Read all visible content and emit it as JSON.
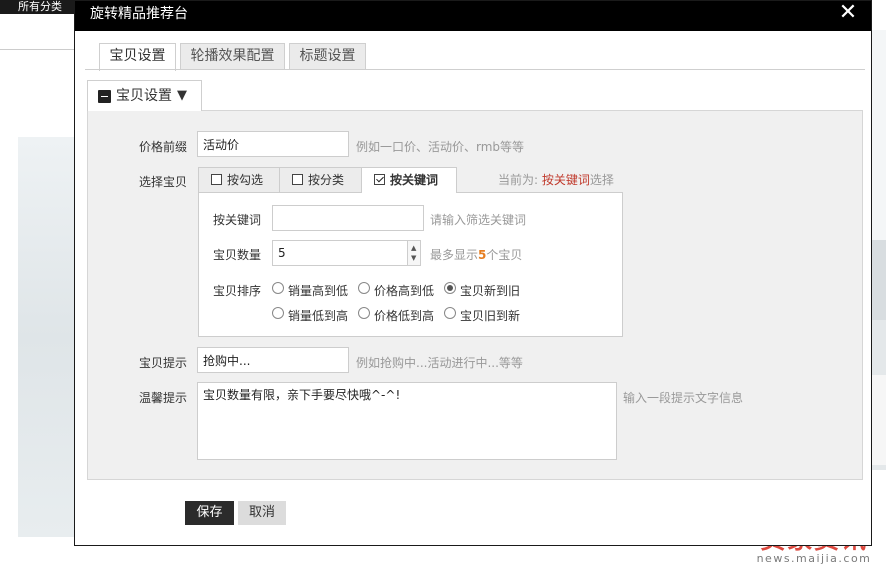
{
  "background": {
    "all_categories": "所有分类"
  },
  "watermark": {
    "brand": "卖家资讯",
    "url": "news.maijia.com"
  },
  "dialog": {
    "title": "旋转精品推荐台",
    "close_symbol": "✕",
    "tabs": [
      {
        "label": "宝贝设置",
        "active": true
      },
      {
        "label": "轮播效果配置",
        "active": false
      },
      {
        "label": "标题设置",
        "active": false
      }
    ],
    "section": {
      "label": "宝贝设置",
      "caret": "▼"
    },
    "price_prefix": {
      "label": "价格前缀",
      "value": "活动价",
      "hint": "例如一口价、活动价、rmb等等"
    },
    "select_item": {
      "label": "选择宝贝",
      "tabs": [
        {
          "label": "按勾选",
          "checked": false,
          "active": false
        },
        {
          "label": "按分类",
          "checked": false,
          "active": false
        },
        {
          "label": "按关键词",
          "checked": true,
          "active": true
        }
      ],
      "current_prefix": "当前为:",
      "current_value": "按关键词",
      "current_suffix": "选择"
    },
    "keyword": {
      "label": "按关键词",
      "value": "",
      "hint": "请输入筛选关键词"
    },
    "item_count": {
      "label": "宝贝数量",
      "value": "5",
      "hint_prefix": "最多显示",
      "hint_number": "5",
      "hint_suffix": "个宝贝"
    },
    "sort": {
      "label": "宝贝排序",
      "options": [
        {
          "label": "销量高到低",
          "checked": false
        },
        {
          "label": "价格高到低",
          "checked": false
        },
        {
          "label": "宝贝新到旧",
          "checked": true
        },
        {
          "label": "销量低到高",
          "checked": false
        },
        {
          "label": "价格低到高",
          "checked": false
        },
        {
          "label": "宝贝旧到新",
          "checked": false
        }
      ]
    },
    "item_tip": {
      "label": "宝贝提示",
      "value": "抢购中...",
      "hint": "例如抢购中...活动进行中...等等"
    },
    "warm_tip": {
      "label": "温馨提示",
      "value": "宝贝数量有限，亲下手要尽快哦^-^!",
      "hint": "输入一段提示文字信息"
    },
    "buttons": {
      "save": "保存",
      "cancel": "取消"
    }
  }
}
